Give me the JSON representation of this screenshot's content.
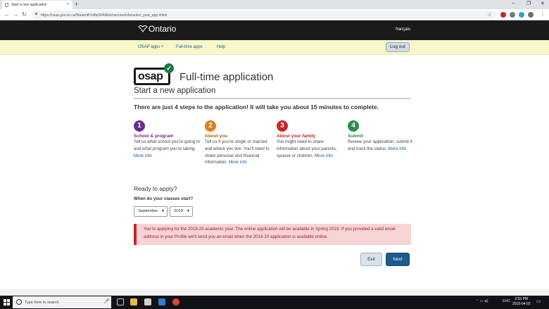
{
  "browser": {
    "tab_title": "Start a new application",
    "tab_close": "×",
    "new_tab": "+",
    "url": "https://osap.gov.on.ca/StudentProfileSFAWeb/secured/sfa/select_year_app.xhtml",
    "window_controls": [
      "–",
      "❐",
      "✕"
    ]
  },
  "header": {
    "logo_text": "Ontario",
    "language_link": "français"
  },
  "subnav": {
    "osap_apps": "OSAP apps ˅",
    "full_time_apps": "Full-time apps",
    "help": "Help",
    "logout": "Log out"
  },
  "main": {
    "osap_logo": "osap",
    "title": "Full-time application",
    "subtitle": "Start a new application",
    "intro": "There are just 4 steps to the application! It will take you about 15 minutes to complete.",
    "steps": [
      {
        "number": "1",
        "title": "School & program",
        "desc": "Tell us what school you're going to and what program you're taking.",
        "more": "More info",
        "color": "#6a2c8e"
      },
      {
        "number": "2",
        "title": "About you",
        "desc": "Tell us if you're single or married and where you live. You'll need to share personal and financial information.",
        "more": "More info",
        "color": "#e07a1f"
      },
      {
        "number": "3",
        "title": "About your family",
        "desc": "You might need to share information about your parents, spouse or children.",
        "more": "More info",
        "color": "#c9242b"
      },
      {
        "number": "4",
        "title": "Submit",
        "desc": "Review your application, submit it and track the status.",
        "more": "More info",
        "color": "#2e8b4e"
      }
    ],
    "ready_heading": "Ready to apply?",
    "when_label": "When do your classes start?",
    "month_selected": "September",
    "year_selected": "2019",
    "alert_text": "You're applying for the 2019-20 academic year. The online application will be available in Spring 2019. If you provided a valid email address in your Profile we'll send you an email when the 2019-20 application is available online.",
    "exit_label": "Exit",
    "next_label": "Next"
  },
  "taskbar": {
    "search_placeholder": "Type here to search",
    "lang": "ENG",
    "time": "2:53 PM",
    "date": "2019-04-02"
  }
}
